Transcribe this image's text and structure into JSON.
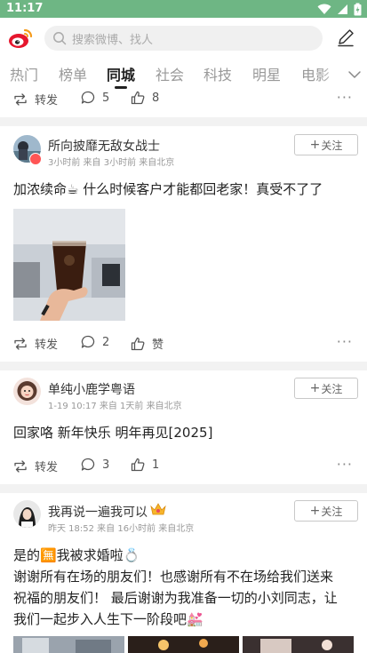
{
  "status_bar": {
    "time": "11:17"
  },
  "header": {
    "search_placeholder": "搜索微博、找人"
  },
  "tabs": [
    "热门",
    "榜单",
    "同城",
    "社会",
    "科技",
    "明星",
    "电影"
  ],
  "active_tab": "同城",
  "prev_post": {
    "repost": "转发",
    "comments": "5",
    "likes": "8"
  },
  "posts": [
    {
      "username": "所向披靡无敌女战士",
      "meta": "3小时前 来自 3小时前 来自北京",
      "follow": "关注",
      "text": "加浓续命☕ 什么时候客户才能都回老家！真受不了了",
      "repost": "转发",
      "comments": "2",
      "likes": "赞"
    },
    {
      "username": "单纯小鹿学粤语",
      "meta": "1-19 10:17 来自 1天前 来自北京",
      "follow": "关注",
      "text": "回家咯 新年快乐 明年再见[2025]",
      "repost": "转发",
      "comments": "3",
      "likes": "1"
    },
    {
      "username": "我再说一遍我可以",
      "meta": "昨天 18:52 来自 16小时前 来自北京",
      "follow": "关注",
      "text_lines": [
        "是的🈚我被求婚啦💍",
        "谢谢所有在场的朋友们！也感谢所有不在场给我们送来",
        "祝福的朋友们！ 最后谢谢为我准备一切的小刘同志，让",
        "我们一起步入人生下一阶段吧💒"
      ]
    }
  ],
  "colors": {
    "status_bar": "#6eb684",
    "weibo_red": "#e6162d",
    "follow_border": "#c8c8c8"
  }
}
